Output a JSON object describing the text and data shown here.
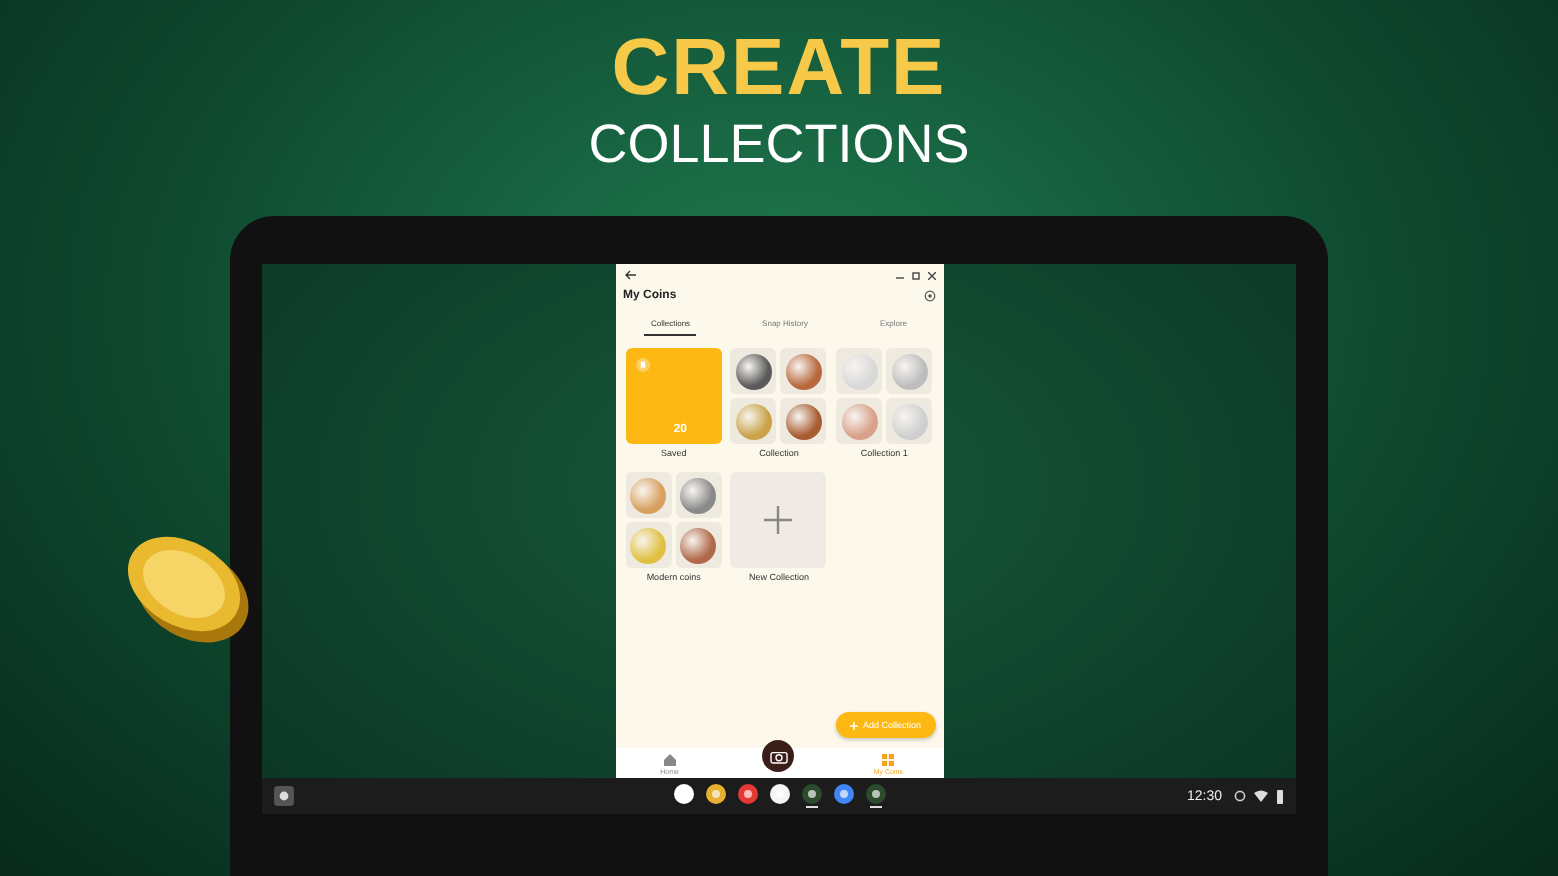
{
  "headline": {
    "title": "CREATE",
    "subtitle": "COLLECTIONS"
  },
  "app": {
    "title": "My Coins",
    "tabs": [
      {
        "label": "Collections",
        "selected": true
      },
      {
        "label": "Snap History",
        "selected": false
      },
      {
        "label": "Explore",
        "selected": false
      }
    ],
    "collections": [
      {
        "kind": "saved",
        "name": "Saved",
        "count": "20"
      },
      {
        "kind": "coins",
        "name": "Collection"
      },
      {
        "kind": "coins",
        "name": "Collection 1"
      },
      {
        "kind": "coins",
        "name": "Modern coins"
      },
      {
        "kind": "new",
        "name": "New Collection"
      }
    ],
    "fab": "Add Collection",
    "nav": [
      {
        "kind": "home",
        "label": "Home",
        "selected": false
      },
      {
        "kind": "camera",
        "selected": false
      },
      {
        "kind": "coins",
        "label": "My Coins",
        "selected": true
      }
    ]
  },
  "taskbar": {
    "time": "12:30",
    "apps": [
      {
        "kind": "mail",
        "active": false
      },
      {
        "kind": "browser",
        "active": false
      },
      {
        "kind": "video",
        "active": false
      },
      {
        "kind": "photos",
        "active": false
      },
      {
        "kind": "coin",
        "active": true
      },
      {
        "kind": "chat",
        "active": false
      },
      {
        "kind": "coin",
        "active": true
      }
    ]
  }
}
